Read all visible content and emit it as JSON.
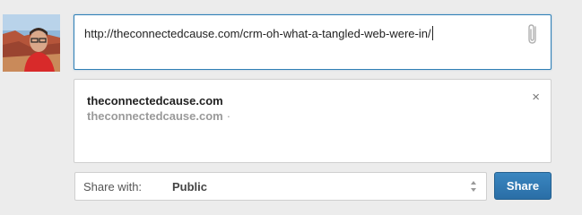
{
  "composer": {
    "text": "http://theconnectedcause.com/crm-oh-what-a-tangled-web-were-in/",
    "attach_icon": "paperclip-icon"
  },
  "preview": {
    "title": "theconnectedcause.com",
    "source": "theconnectedcause.com",
    "separator": "·",
    "close_label": "×"
  },
  "share_with": {
    "label": "Share with:",
    "value": "Public"
  },
  "share_button": {
    "label": "Share"
  },
  "colors": {
    "accent": "#2f7fb6",
    "button": "#2a6ea6"
  }
}
